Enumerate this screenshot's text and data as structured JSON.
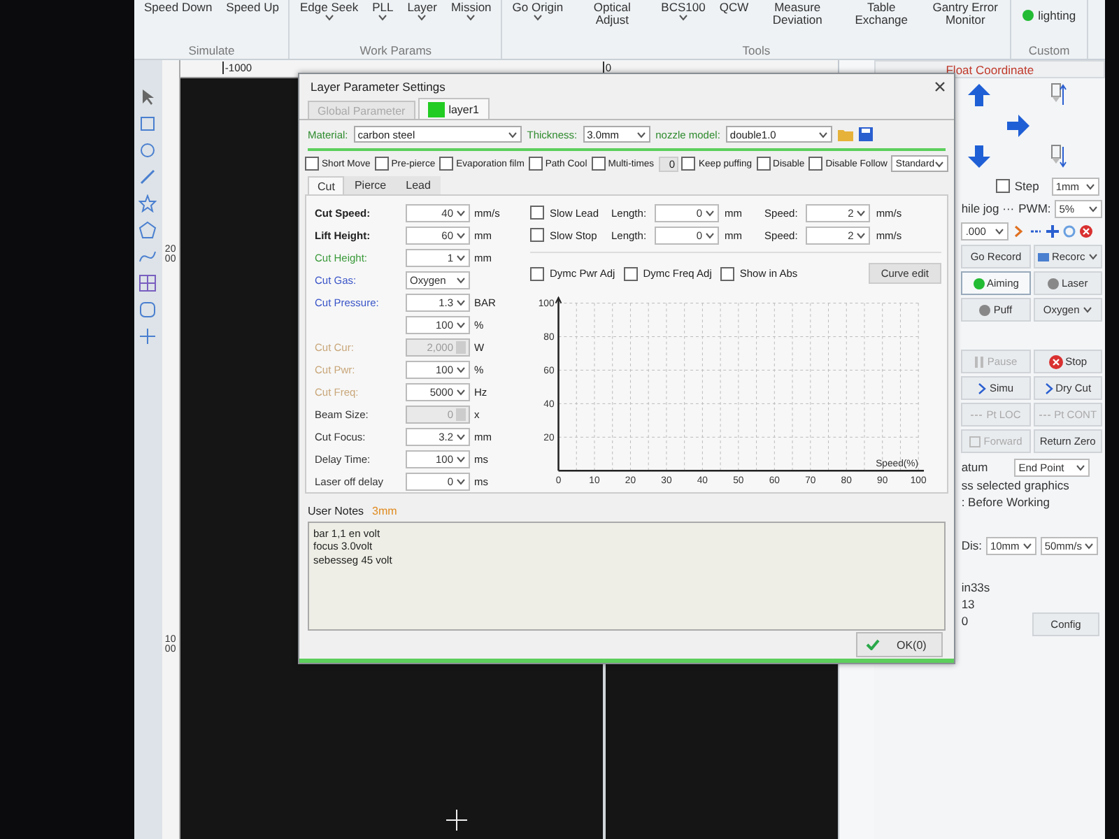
{
  "ribbon": {
    "groups": [
      {
        "label": "Simulate",
        "items": [
          {
            "label": "Speed Down",
            "dropdown": false
          },
          {
            "label": "Speed Up",
            "dropdown": false
          }
        ]
      },
      {
        "label": "Work Params",
        "items": [
          {
            "label": "Edge Seek",
            "dropdown": true
          },
          {
            "label": "PLL",
            "dropdown": true
          },
          {
            "label": "Layer",
            "dropdown": true
          },
          {
            "label": "Mission",
            "dropdown": true
          }
        ]
      },
      {
        "label": "Tools",
        "items": [
          {
            "label": "Go Origin",
            "dropdown": true
          },
          {
            "label": "Optical Adjust",
            "dropdown": false
          },
          {
            "label": "BCS100",
            "dropdown": true
          },
          {
            "label": "QCW",
            "dropdown": false
          },
          {
            "label": "Measure Deviation",
            "dropdown": false
          },
          {
            "label": "Table Exchange",
            "dropdown": false
          },
          {
            "label": "Gantry Error Monitor",
            "dropdown": false
          }
        ]
      },
      {
        "label": "Custom",
        "toggle": {
          "label": "lighting",
          "on": true
        }
      }
    ]
  },
  "ruler": {
    "labels": [
      "-1000",
      "0"
    ],
    "side_labels": [
      "2000",
      "1000"
    ]
  },
  "right_panel": {
    "coordinate_mode": "Float Coordinate",
    "step": {
      "label": "Step",
      "checked": false,
      "value": "1mm"
    },
    "jog_label": "hile jog ···",
    "pwm": {
      "label": "PWM:",
      "value": "5%"
    },
    "jog_speed": ".000",
    "buttons": [
      {
        "label": "Go Record",
        "kind": "plain",
        "disabled": false
      },
      {
        "label": "Recorc",
        "kind": "menu",
        "disabled": false
      },
      {
        "label": "Aiming",
        "kind": "lamp_on",
        "disabled": false
      },
      {
        "label": "Laser",
        "kind": "lamp_off",
        "disabled": false
      },
      {
        "label": "Puff",
        "kind": "lamp_off",
        "disabled": false
      },
      {
        "label": "Oxygen",
        "kind": "dropdown",
        "disabled": false
      }
    ],
    "run_buttons": [
      {
        "label": "Pause",
        "kind": "pause",
        "disabled": true
      },
      {
        "label": "Stop",
        "kind": "stop",
        "disabled": false
      },
      {
        "label": "Simu",
        "kind": "play",
        "disabled": false
      },
      {
        "label": "Dry Cut",
        "kind": "play",
        "disabled": false
      },
      {
        "label": "Pt LOC",
        "kind": "step",
        "disabled": true
      },
      {
        "label": "Pt CONT",
        "kind": "step",
        "disabled": true
      },
      {
        "label": "Forward",
        "kind": "forward",
        "disabled": true
      },
      {
        "label": "Return Zero",
        "kind": "plain",
        "disabled": false
      }
    ],
    "return": {
      "label": "atum",
      "value": "End Point"
    },
    "options": [
      "ss selected graphics",
      ": Before Working"
    ],
    "dis": {
      "label": "Dis:",
      "values": [
        "10mm",
        "50mm/s"
      ]
    },
    "stats": [
      "in33s",
      "13",
      "0"
    ],
    "config": "Config"
  },
  "dialog": {
    "title": "Layer Parameter Settings",
    "tabs": [
      {
        "label": "Global Parameter",
        "selected": false
      },
      {
        "label": "layer1",
        "selected": true,
        "color": "#22cc22"
      }
    ],
    "material": {
      "label": "Material:",
      "value": "carbon steel"
    },
    "thickness": {
      "label": "Thickness:",
      "value": "3.0mm"
    },
    "nozzle": {
      "label": "nozzle model:",
      "value": "double1.0"
    },
    "options": [
      {
        "label": "Short Move",
        "checked": false
      },
      {
        "label": "Pre-pierce",
        "checked": false
      },
      {
        "label": "Evaporation film",
        "checked": false
      },
      {
        "label": "Path Cool",
        "checked": false
      },
      {
        "label": "Multi-times",
        "checked": false
      }
    ],
    "multi_times_value": "0",
    "options_2": [
      {
        "label": "Keep puffing",
        "checked": false
      },
      {
        "label": "Disable",
        "checked": false
      },
      {
        "label": "Disable Follow",
        "checked": false
      }
    ],
    "follow_mode": "Standard",
    "subtabs": [
      {
        "label": "Cut",
        "selected": true
      },
      {
        "label": "Pierce",
        "selected": false
      },
      {
        "label": "Lead",
        "selected": false
      }
    ],
    "params": [
      {
        "label": "Cut Speed:",
        "kind": "bold",
        "value": "40",
        "unit": "mm/s",
        "disabled": false
      },
      {
        "label": "Lift Height:",
        "kind": "bold",
        "value": "60",
        "unit": "mm",
        "disabled": false
      },
      {
        "label": "Cut Height:",
        "kind": "green",
        "value": "1",
        "unit": "mm",
        "disabled": false
      },
      {
        "label": "Cut Gas:",
        "kind": "blue",
        "value": "Oxygen",
        "disabled": false
      },
      {
        "label": "Cut Pressure:",
        "kind": "blue",
        "value": "1.3",
        "unit": "BAR",
        "disabled": false
      },
      {
        "kind": "plain",
        "value": "100",
        "unit": "%",
        "disabled": false
      },
      {
        "label": "Cut Cur:",
        "kind": "tan",
        "value": "2,000",
        "unit": "W",
        "disabled": true
      },
      {
        "label": "Cut Pwr:",
        "kind": "tan",
        "value": "100",
        "unit": "%",
        "disabled": false
      },
      {
        "label": "Cut Freq:",
        "kind": "tan",
        "value": "5000",
        "unit": "Hz",
        "disabled": false
      },
      {
        "label": "Beam Size:",
        "kind": "plain",
        "value": "0",
        "unit": "x",
        "disabled": true
      },
      {
        "label": "Cut Focus:",
        "kind": "plain",
        "value": "3.2",
        "unit": "mm",
        "disabled": false
      },
      {
        "label": "Delay Time:",
        "kind": "plain",
        "value": "100",
        "unit": "ms",
        "disabled": false
      },
      {
        "label": "Laser off delay",
        "kind": "plain",
        "value": "0",
        "unit": "ms",
        "disabled": false
      }
    ],
    "slow": [
      {
        "label": "Slow Lead",
        "checked": false,
        "length_label": "Length:",
        "length": "0",
        "length_unit": "mm",
        "speed_label": "Speed:",
        "speed": "2",
        "speed_unit": "mm/s"
      },
      {
        "label": "Slow Stop",
        "checked": false,
        "length_label": "Length:",
        "length": "0",
        "length_unit": "mm",
        "speed_label": "Speed:",
        "speed": "2",
        "speed_unit": "mm/s"
      }
    ],
    "chart_options": [
      {
        "label": "Dymc Pwr Adj",
        "checked": false
      },
      {
        "label": "Dymc Freq Adj",
        "checked": false
      },
      {
        "label": "Show in Abs",
        "checked": false
      }
    ],
    "curve_button": "Curve edit",
    "chart_data": {
      "type": "line",
      "grid": true,
      "xlabel": "Speed(%)",
      "xlim": [
        0,
        100
      ],
      "ylim": [
        0,
        100
      ],
      "xticks": [
        0,
        10,
        20,
        30,
        40,
        50,
        60,
        70,
        80,
        90,
        100
      ],
      "yticks": [
        20,
        40,
        60,
        80,
        100
      ]
    },
    "notes_label": "User Notes",
    "notes_tag": "3mm",
    "notes": "bar 1,1 en volt\nfocus 3.0volt\nsebesseg 45 volt",
    "ok_button": "OK(0)"
  }
}
